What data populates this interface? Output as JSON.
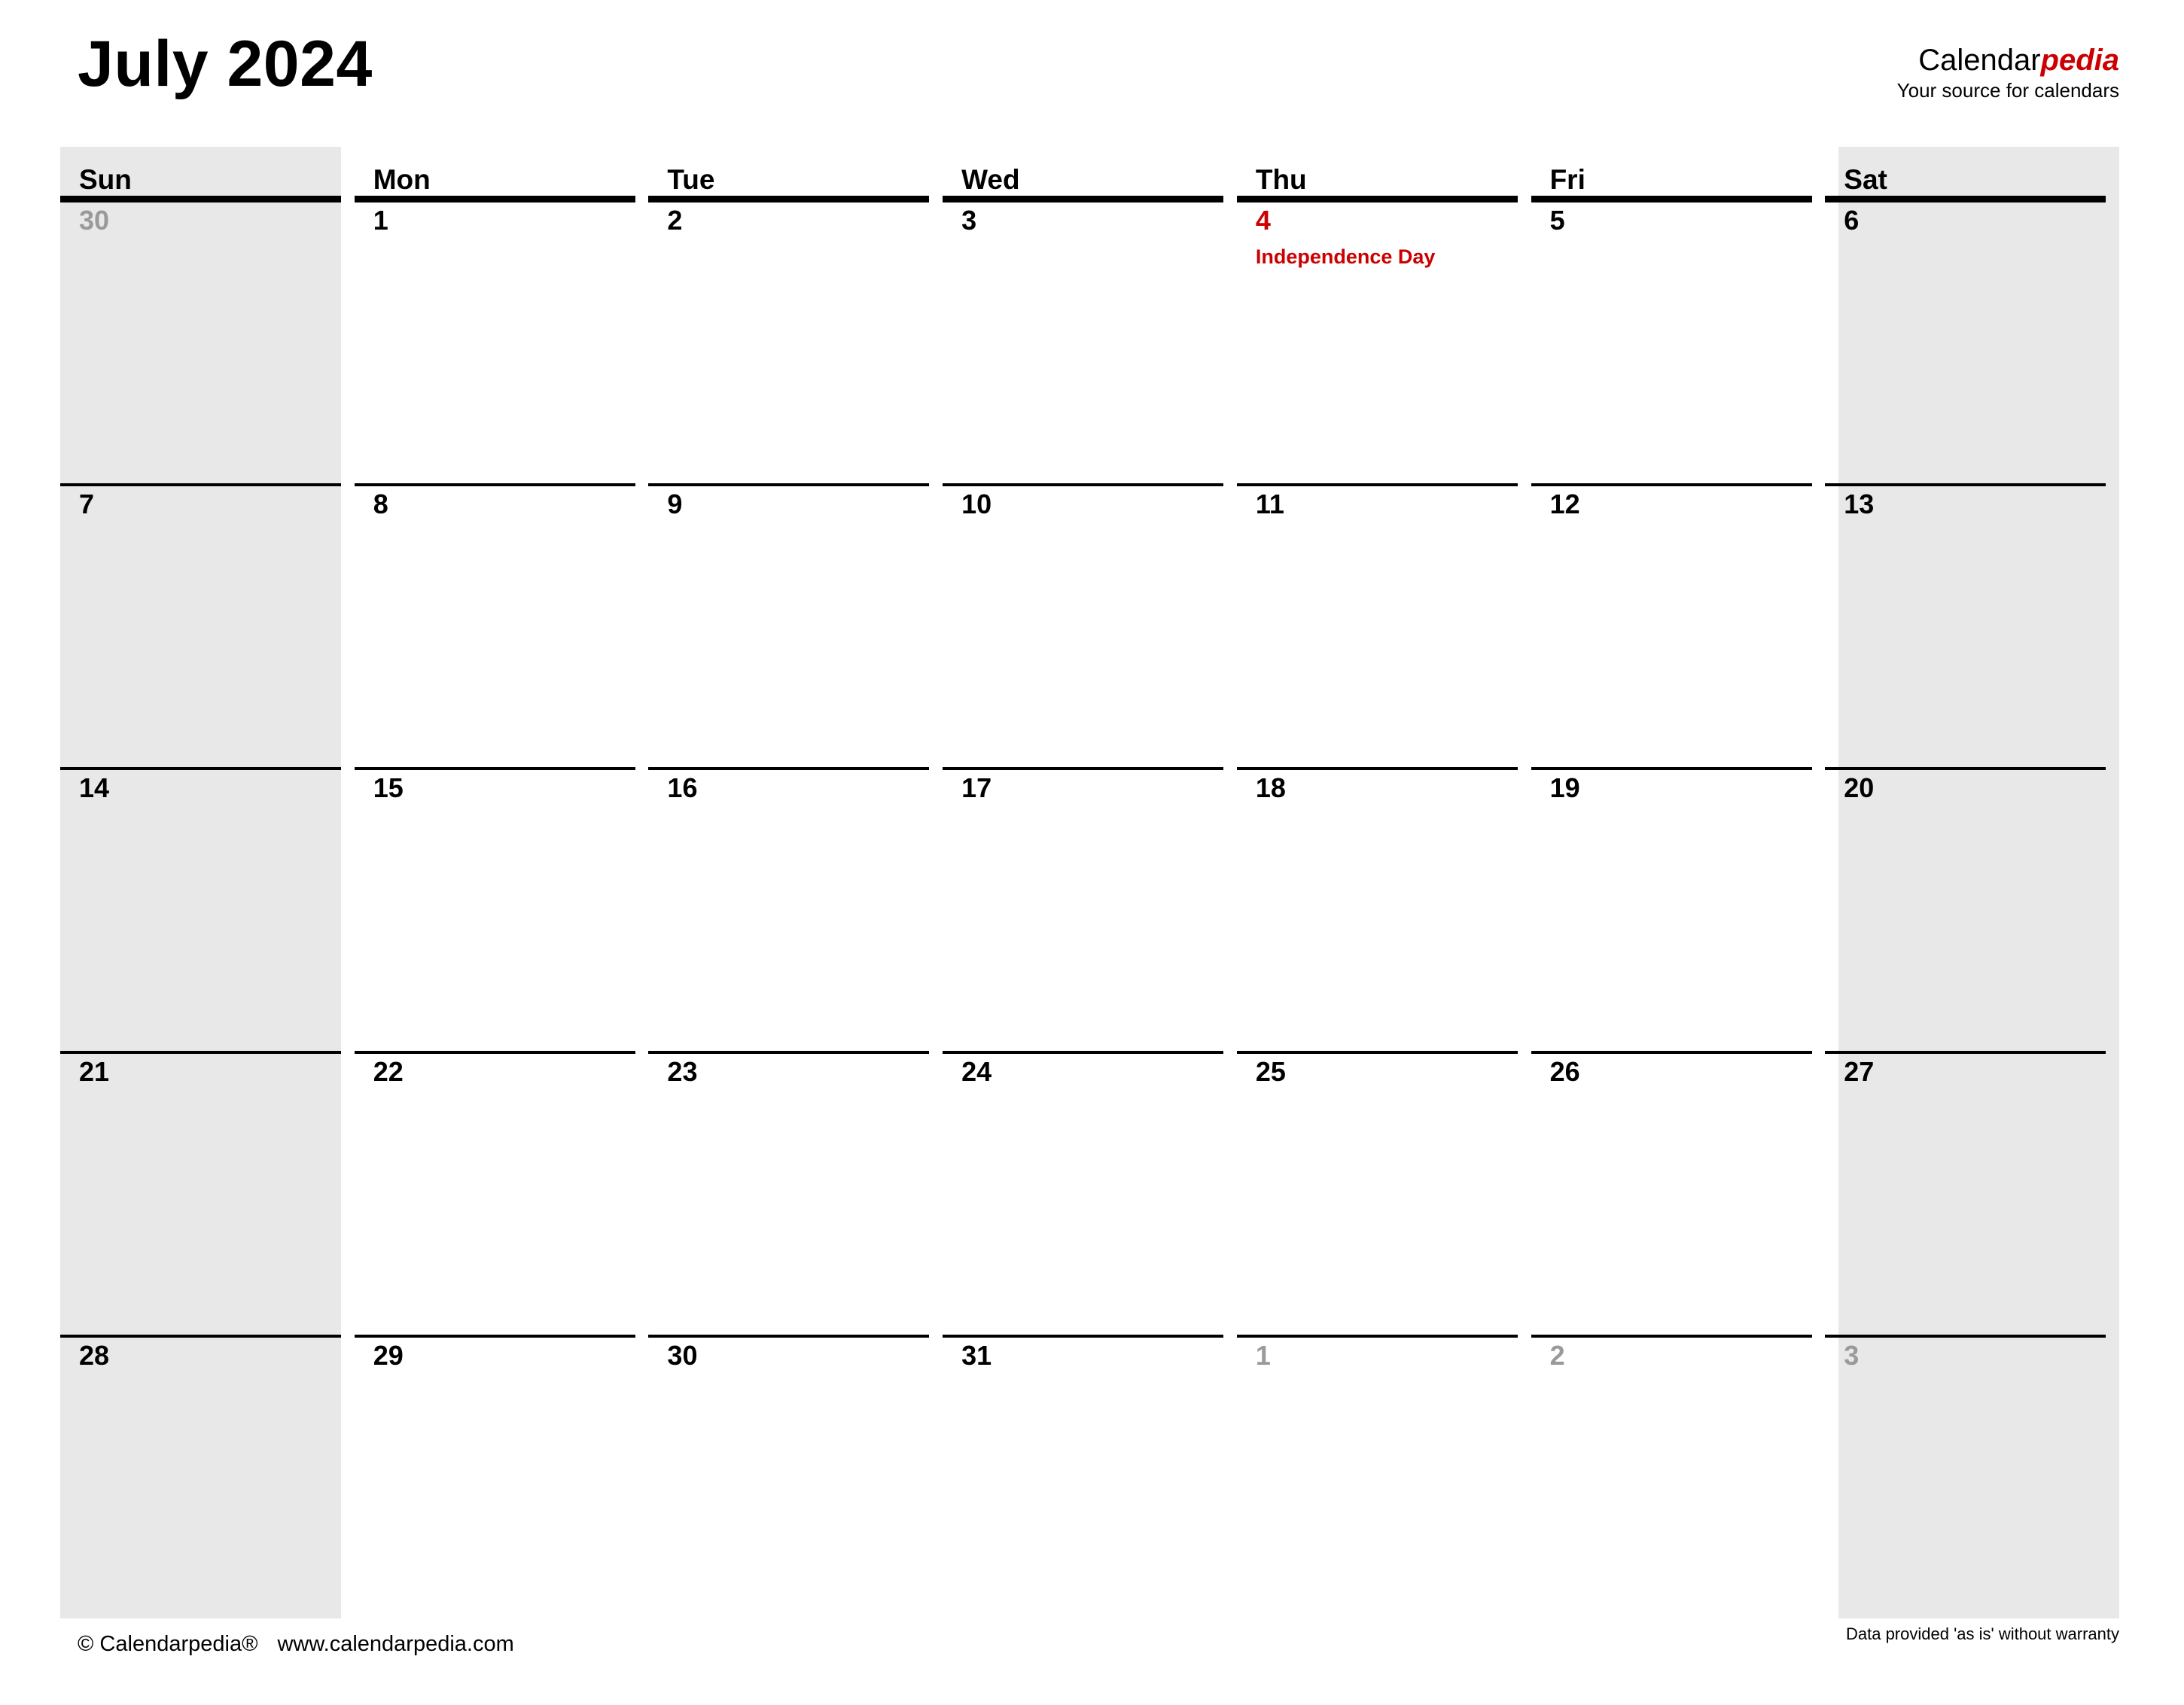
{
  "header": {
    "month_title": "July 2024",
    "brand_primary": "Calendar",
    "brand_accent": "pedia",
    "brand_tagline": "Your source for calendars"
  },
  "colors": {
    "accent_red": "#cc0000",
    "weekend_shade": "#e8e8e8",
    "adjacent_day": "#9a9a9a",
    "rule": "#000000"
  },
  "calendar": {
    "month": "July",
    "year": "2024",
    "week_start": "Sun",
    "weekday_headers": [
      "Sun",
      "Mon",
      "Tue",
      "Wed",
      "Thu",
      "Fri",
      "Sat"
    ],
    "shaded_columns": [
      "Sun",
      "Sat"
    ],
    "weeks": [
      [
        {
          "day": "30",
          "adjacent": true,
          "holiday": null
        },
        {
          "day": "1",
          "adjacent": false,
          "holiday": null
        },
        {
          "day": "2",
          "adjacent": false,
          "holiday": null
        },
        {
          "day": "3",
          "adjacent": false,
          "holiday": null
        },
        {
          "day": "4",
          "adjacent": false,
          "holiday": "Independence Day"
        },
        {
          "day": "5",
          "adjacent": false,
          "holiday": null
        },
        {
          "day": "6",
          "adjacent": false,
          "holiday": null
        }
      ],
      [
        {
          "day": "7",
          "adjacent": false,
          "holiday": null
        },
        {
          "day": "8",
          "adjacent": false,
          "holiday": null
        },
        {
          "day": "9",
          "adjacent": false,
          "holiday": null
        },
        {
          "day": "10",
          "adjacent": false,
          "holiday": null
        },
        {
          "day": "11",
          "adjacent": false,
          "holiday": null
        },
        {
          "day": "12",
          "adjacent": false,
          "holiday": null
        },
        {
          "day": "13",
          "adjacent": false,
          "holiday": null
        }
      ],
      [
        {
          "day": "14",
          "adjacent": false,
          "holiday": null
        },
        {
          "day": "15",
          "adjacent": false,
          "holiday": null
        },
        {
          "day": "16",
          "adjacent": false,
          "holiday": null
        },
        {
          "day": "17",
          "adjacent": false,
          "holiday": null
        },
        {
          "day": "18",
          "adjacent": false,
          "holiday": null
        },
        {
          "day": "19",
          "adjacent": false,
          "holiday": null
        },
        {
          "day": "20",
          "adjacent": false,
          "holiday": null
        }
      ],
      [
        {
          "day": "21",
          "adjacent": false,
          "holiday": null
        },
        {
          "day": "22",
          "adjacent": false,
          "holiday": null
        },
        {
          "day": "23",
          "adjacent": false,
          "holiday": null
        },
        {
          "day": "24",
          "adjacent": false,
          "holiday": null
        },
        {
          "day": "25",
          "adjacent": false,
          "holiday": null
        },
        {
          "day": "26",
          "adjacent": false,
          "holiday": null
        },
        {
          "day": "27",
          "adjacent": false,
          "holiday": null
        }
      ],
      [
        {
          "day": "28",
          "adjacent": false,
          "holiday": null
        },
        {
          "day": "29",
          "adjacent": false,
          "holiday": null
        },
        {
          "day": "30",
          "adjacent": false,
          "holiday": null
        },
        {
          "day": "31",
          "adjacent": false,
          "holiday": null
        },
        {
          "day": "1",
          "adjacent": true,
          "holiday": null
        },
        {
          "day": "2",
          "adjacent": true,
          "holiday": null
        },
        {
          "day": "3",
          "adjacent": true,
          "holiday": null
        }
      ]
    ]
  },
  "footer": {
    "copyright": "© Calendarpedia®",
    "website": "www.calendarpedia.com",
    "disclaimer": "Data provided 'as is' without warranty"
  }
}
